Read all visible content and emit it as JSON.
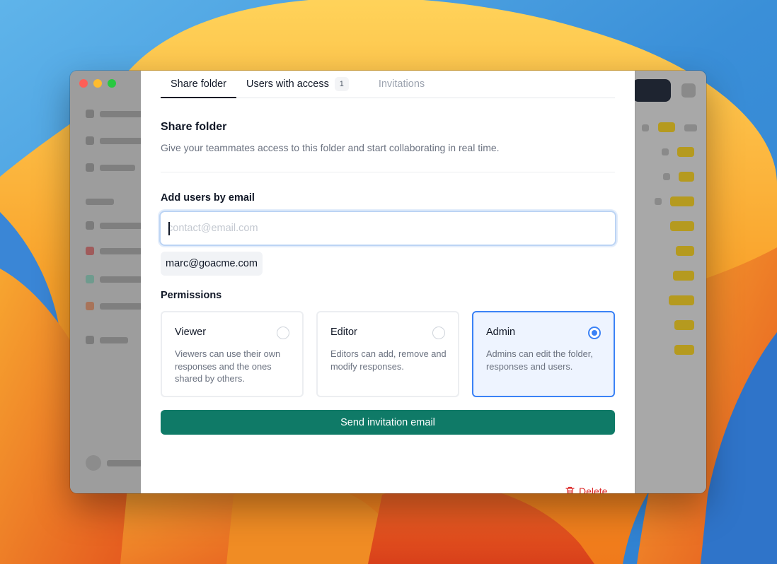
{
  "tabs": [
    {
      "label": "Share folder",
      "active": true
    },
    {
      "label": "Users with access",
      "count": "1"
    },
    {
      "label": "Invitations",
      "muted": true
    }
  ],
  "share": {
    "title": "Share folder",
    "description": "Give your teammates access to this folder and start collaborating in real time."
  },
  "add_users": {
    "label": "Add users by email",
    "input_placeholder": "contact@email.com",
    "input_value": "",
    "chips": [
      "marc@goacme.com"
    ]
  },
  "permissions": {
    "label": "Permissions",
    "options": [
      {
        "name": "Viewer",
        "description": "Viewers can use their own responses and the ones shared by others.",
        "selected": false
      },
      {
        "name": "Editor",
        "description": "Editors can add, remove and modify responses.",
        "selected": false
      },
      {
        "name": "Admin",
        "description": "Admins can edit the folder, responses and users.",
        "selected": true
      }
    ]
  },
  "actions": {
    "send_label": "Send invitation email",
    "delete_label": "Delete"
  },
  "colors": {
    "accent": "#3b82f6",
    "primary_button": "#0f7a67",
    "danger": "#dc2626"
  },
  "icons": {
    "delete": "trash-icon",
    "window_close": "close-dot",
    "window_minimize": "minimize-dot",
    "window_zoom": "zoom-dot"
  }
}
